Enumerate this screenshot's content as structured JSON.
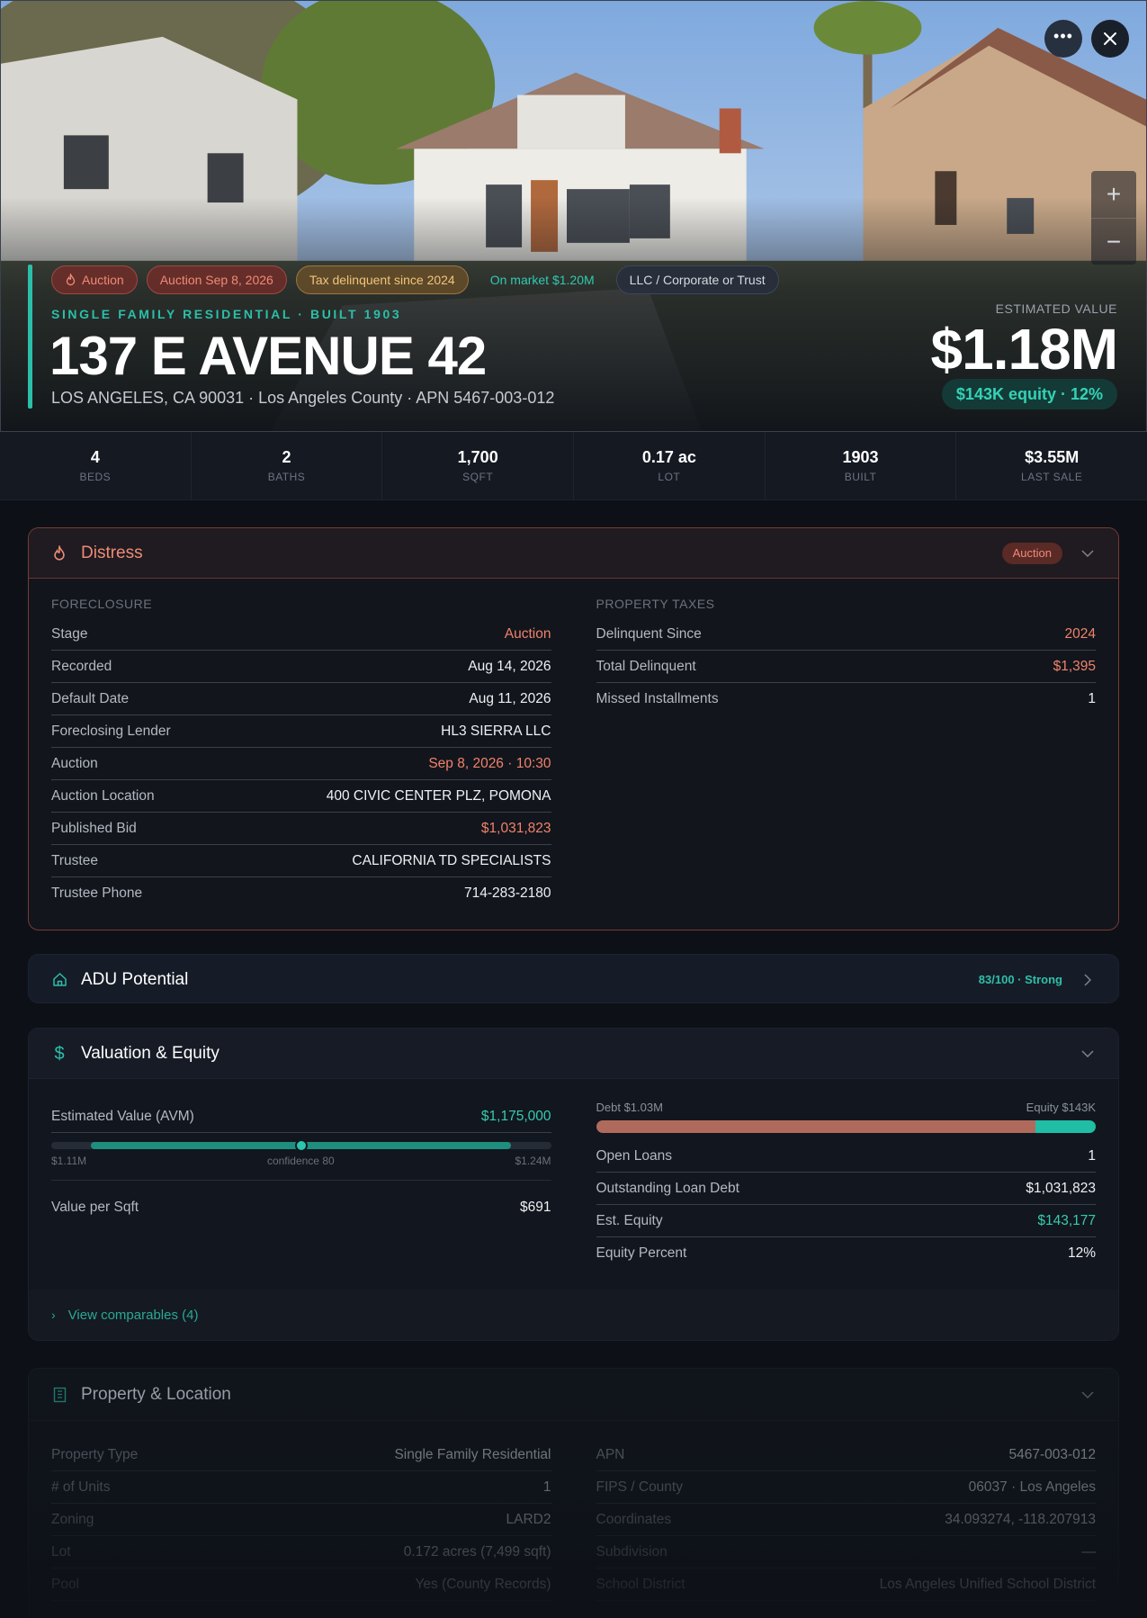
{
  "hero": {
    "badges": {
      "auction": "Auction",
      "auction_date": "Auction Sep 8, 2026",
      "tax": "Tax delinquent since 2024",
      "market": "On market $1.20M",
      "llc": "LLC / Corporate or Trust"
    },
    "subtitle": "SINGLE FAMILY RESIDENTIAL · BUILT 1903",
    "title": "137 E AVENUE 42",
    "address": "LOS ANGELES, CA 90031 · Los Angeles County · APN 5467-003-012",
    "estimated_label": "ESTIMATED VALUE",
    "estimated_value": "$1.18M",
    "equity_pill": "$143K equity · 12%",
    "zoom_in": "+",
    "zoom_out": "−"
  },
  "stats": [
    {
      "value": "4",
      "label": "BEDS"
    },
    {
      "value": "2",
      "label": "BATHS"
    },
    {
      "value": "1,700",
      "label": "SQFT"
    },
    {
      "value": "0.17 ac",
      "label": "LOT"
    },
    {
      "value": "1903",
      "label": "BUILT"
    },
    {
      "value": "$3.55M",
      "label": "LAST SALE"
    }
  ],
  "distress": {
    "title": "Distress",
    "badge": "Auction",
    "foreclosure_label": "FORECLOSURE",
    "foreclosure": [
      {
        "k": "Stage",
        "v": "Auction"
      },
      {
        "k": "Recorded",
        "v": "Aug 14, 2026"
      },
      {
        "k": "Default Date",
        "v": "Aug 11, 2026"
      },
      {
        "k": "Foreclosing Lender",
        "v": "HL3 SIERRA LLC"
      },
      {
        "k": "Auction",
        "v": "Sep 8, 2026 · 10:30"
      },
      {
        "k": "Auction Location",
        "v": "400 CIVIC CENTER PLZ, POMONA"
      },
      {
        "k": "Published Bid",
        "v": "$1,031,823"
      },
      {
        "k": "Trustee",
        "v": "CALIFORNIA TD SPECIALISTS"
      },
      {
        "k": "Trustee Phone",
        "v": "714-283-2180"
      }
    ],
    "taxes_label": "PROPERTY TAXES",
    "taxes": [
      {
        "k": "Delinquent Since",
        "v": "2024"
      },
      {
        "k": "Total Delinquent",
        "v": "$1,395"
      },
      {
        "k": "Missed Installments",
        "v": "1"
      }
    ]
  },
  "adu": {
    "title": "ADU Potential",
    "score": "83/100 · Strong"
  },
  "valuation": {
    "title": "Valuation & Equity",
    "avm_label": "Estimated Value (AVM)",
    "avm_value": "$1,175,000",
    "range_low": "$1.11M",
    "range_mid": "confidence 80",
    "range_high": "$1.24M",
    "range_fill_start": 0.08,
    "range_fill_end": 0.92,
    "range_marker": 0.5,
    "value_per_sqft_label": "Value per Sqft",
    "value_per_sqft": "$691",
    "debt_label": "Debt $1.03M",
    "equity_label": "Equity $143K",
    "debt_fraction": 0.88,
    "rows": [
      {
        "k": "Open Loans",
        "v": "1"
      },
      {
        "k": "Outstanding Loan Debt",
        "v": "$1,031,823"
      },
      {
        "k": "Est. Equity",
        "v": "$143,177"
      },
      {
        "k": "Equity Percent",
        "v": "12%"
      }
    ],
    "comparables": "View comparables (4)"
  },
  "property": {
    "title": "Property & Location",
    "left": [
      {
        "k": "Property Type",
        "v": "Single Family Residential"
      },
      {
        "k": "# of Units",
        "v": "1"
      },
      {
        "k": "Zoning",
        "v": "LARD2"
      },
      {
        "k": "Lot",
        "v": "0.172 acres (7,499 sqft)"
      },
      {
        "k": "Pool",
        "v": "Yes (County Records)"
      }
    ],
    "right": [
      {
        "k": "APN",
        "v": "5467-003-012"
      },
      {
        "k": "FIPS / County",
        "v": "06037 · Los Angeles"
      },
      {
        "k": "Coordinates",
        "v": "34.093274, -118.207913"
      },
      {
        "k": "Subdivision",
        "v": "—"
      },
      {
        "k": "School District",
        "v": "Los Angeles Unified School District"
      }
    ]
  },
  "colors": {
    "accent": "#2bbfa9",
    "distress": "#f08a76",
    "background": "#0d1117"
  }
}
